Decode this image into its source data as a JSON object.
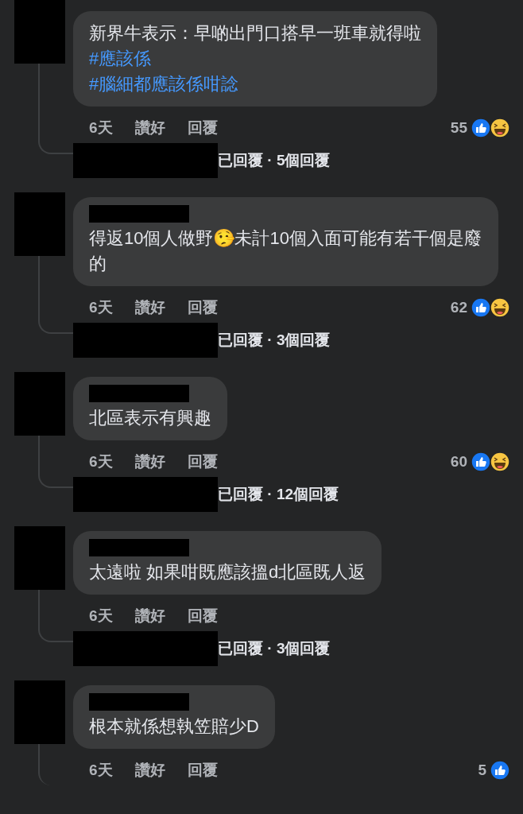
{
  "comments": [
    {
      "text": "新界牛表示：早啲出門口搭早一班車就得啦",
      "hashtags": [
        "#應該係",
        "#腦細都應該係咁諗"
      ],
      "time": "6天",
      "like": "讚好",
      "reply": "回覆",
      "count": "55",
      "reactions": [
        {
          "kind": "like"
        },
        {
          "kind": "haha"
        }
      ],
      "replies": "已回覆 · 5個回覆"
    },
    {
      "name_shown": true,
      "text": "得返10個人做野🤥未計10個入面可能有若干個是廢的",
      "time": "6天",
      "like": "讚好",
      "reply": "回覆",
      "count": "62",
      "reactions": [
        {
          "kind": "like"
        },
        {
          "kind": "haha"
        }
      ],
      "replies": "已回覆 · 3個回覆"
    },
    {
      "name_shown": true,
      "text": "北區表示有興趣",
      "time": "6天",
      "like": "讚好",
      "reply": "回覆",
      "count": "60",
      "reactions": [
        {
          "kind": "like"
        },
        {
          "kind": "haha"
        }
      ],
      "replies": "已回覆 · 12個回覆"
    },
    {
      "name_shown": true,
      "text": "太遠啦 如果咁既應該搵d北區既人返",
      "time": "6天",
      "like": "讚好",
      "reply": "回覆",
      "replies": "已回覆 · 3個回覆"
    },
    {
      "name_shown": true,
      "text": "根本就係想執笠賠少D",
      "time": "6天",
      "like": "讚好",
      "reply": "回覆",
      "count": "5",
      "reactions": [
        {
          "kind": "like"
        }
      ]
    }
  ]
}
